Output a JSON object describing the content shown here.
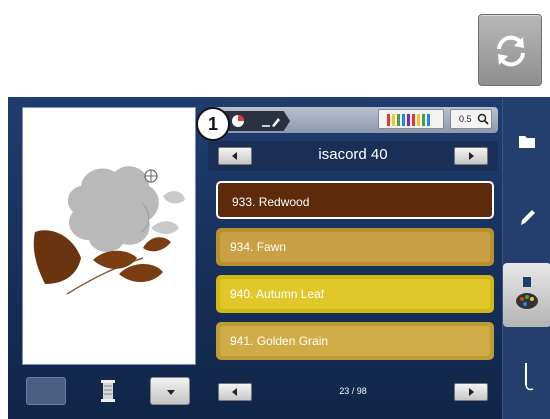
{
  "callout": {
    "number": "1"
  },
  "toolbar": {
    "zoom_label": "0.5"
  },
  "brand_nav": {
    "title": "isacord 40"
  },
  "colors": [
    {
      "label": "933. Redwood",
      "fill": "#5e2a0c",
      "border": "#ffffff",
      "selected": true
    },
    {
      "label": "934. Fawn",
      "fill": "#c39a3c",
      "border": "#d6b14a",
      "selected": false
    },
    {
      "label": "940. Autumn Leaf",
      "fill": "#d9c018",
      "border": "#ead23a",
      "selected": false
    },
    {
      "label": "941. Golden Grain",
      "fill": "#c7a43a",
      "border": "#d8b64d",
      "selected": false
    }
  ],
  "pagination": {
    "text": "23 / 98"
  },
  "palette": {
    "accent": "#1f3d6e",
    "sidebar": "#243f6e"
  }
}
